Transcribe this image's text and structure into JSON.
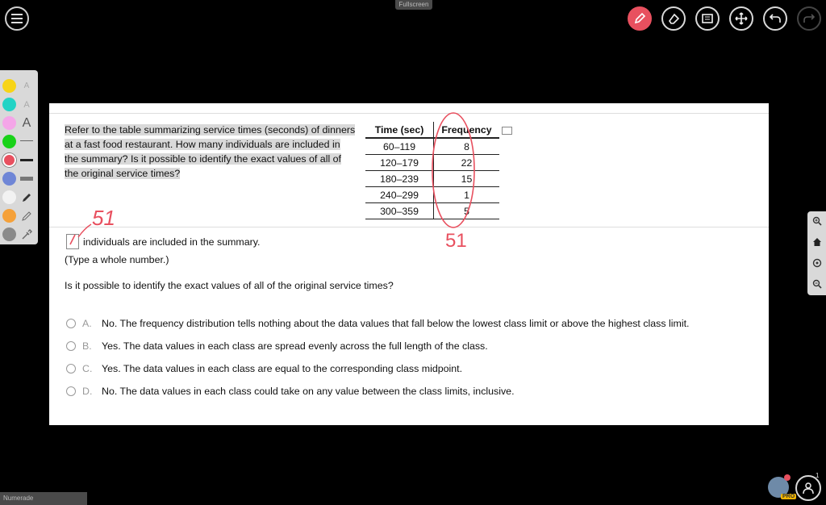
{
  "topbar": {
    "fullscreen_label": "Fullscreen"
  },
  "toolbar": {
    "icons": [
      "pencil-icon",
      "eraser-icon",
      "presentation-icon",
      "move-icon",
      "undo-icon",
      "redo-icon"
    ],
    "active": "pencil-icon",
    "accent": "#e8505f"
  },
  "palette": {
    "colors": [
      "#f7d417",
      "#22d3c5",
      "#f4a6e8",
      "#19d219",
      "#e8505f",
      "#6f86d6",
      "#f2f2f2",
      "#f5a13a",
      "#8a8a8a"
    ],
    "selected": "#e8505f",
    "text_tool": "A"
  },
  "problem": {
    "question": "Refer to the table summarizing service times (seconds) of dinners at a fast food restaurant. How many individuals are included in the summary? Is it possible to identify the exact values of all of the original service times?",
    "table": {
      "headers": [
        "Time (sec)",
        "Frequency"
      ],
      "rows": [
        [
          "60–119",
          "8"
        ],
        [
          "120–179",
          "22"
        ],
        [
          "180–239",
          "15"
        ],
        [
          "240–299",
          "1"
        ],
        [
          "300–359",
          "5"
        ]
      ]
    },
    "answer_suffix": "individuals are included in the summary.",
    "hint": "(Type a whole number.)",
    "question2": "Is it possible to identify the exact values of all of the original service times?",
    "options": [
      {
        "letter": "A.",
        "text": "No. The frequency distribution tells nothing about the data values that fall below the lowest class limit or above the highest class limit."
      },
      {
        "letter": "B.",
        "text": "Yes. The data values in each class are spread evenly across the full length of the class."
      },
      {
        "letter": "C.",
        "text": "Yes. The data values in each class are equal to the corresponding class midpoint."
      },
      {
        "letter": "D.",
        "text": "No. The data values in each class could take on any value between the class limits, inclusive."
      }
    ]
  },
  "annotations": {
    "ink_color": "#e8505f",
    "written_answer": "51",
    "written_total": "51"
  },
  "sidebar_right": {
    "icons": [
      "zoom-in-icon",
      "home-icon",
      "target-icon",
      "zoom-out-icon"
    ]
  },
  "footer": {
    "tab_label": "Numerade",
    "badge": "PRO",
    "participants_count": "1"
  }
}
